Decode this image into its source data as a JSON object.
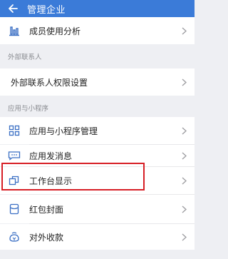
{
  "header": {
    "title": "管理企业"
  },
  "rows": {
    "member_usage": "成员使用分析",
    "external_perm": "外部联系人权限设置",
    "app_manage": "应用与小程序管理",
    "app_message": "应用发消息",
    "workbench_display": "工作台显示",
    "red_packet_cover": "红包封面",
    "external_payment": "对外收款"
  },
  "sections": {
    "external": "外部联系人",
    "apps": "应用与小程序"
  },
  "colors": {
    "header": "#3b7bd8",
    "icon": "#3b6fc4",
    "highlight": "#d71f26"
  }
}
